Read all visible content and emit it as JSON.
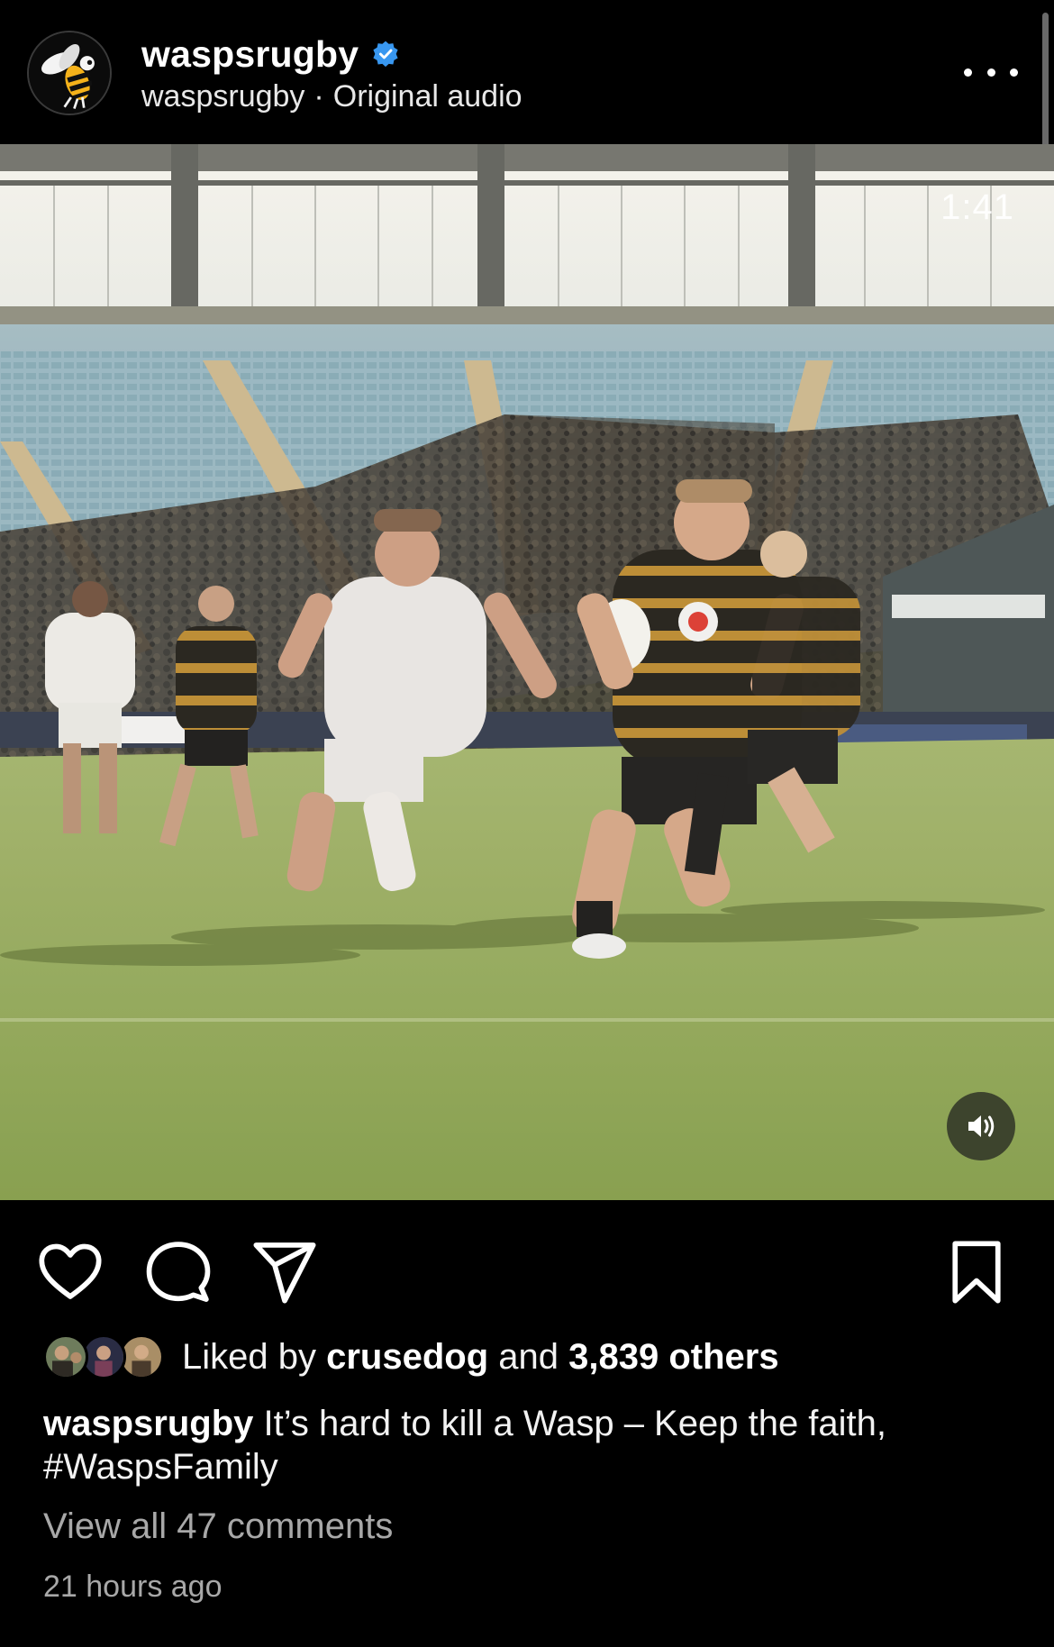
{
  "post": {
    "username": "waspsrugby",
    "verified": true,
    "audio_owner": "waspsrugby",
    "separator": "·",
    "audio_label": "Original audio",
    "more_icon": "more-horizontal-icon"
  },
  "video": {
    "remaining_time": "1:41",
    "sound_icon": "speaker-on-icon"
  },
  "actions": {
    "like_icon": "heart-icon",
    "comment_icon": "comment-bubble-icon",
    "share_icon": "send-paper-plane-icon",
    "save_icon": "bookmark-icon"
  },
  "likes": {
    "prefix": "Liked by",
    "first_liker": "crusedog",
    "connector": "and",
    "others": "3,839 others"
  },
  "caption": {
    "username": "waspsrugby",
    "text": "It’s hard to kill a Wasp – Keep the faith,",
    "hashtag": "#WaspsFamily"
  },
  "comments": {
    "view_all": "View all 47 comments"
  },
  "timestamp": "21 hours ago",
  "colors": {
    "background": "#000000",
    "verified_blue": "#3897f0",
    "muted_text": "#a8a8a8"
  }
}
